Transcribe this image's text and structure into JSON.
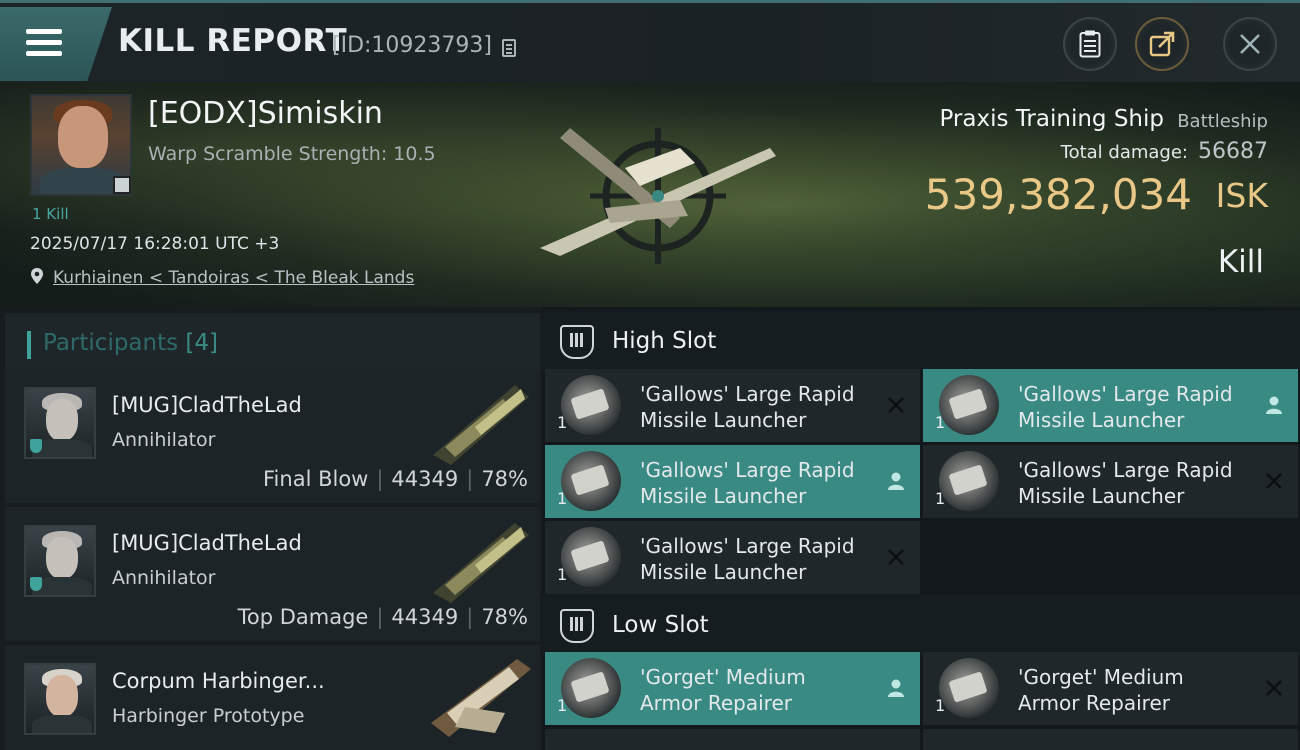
{
  "header": {
    "title": "KILL REPORT",
    "report_id": "[ID:10923793]"
  },
  "victim": {
    "name": "[EODX]Simiskin",
    "warp_scramble": "Warp Scramble Strength: 10.5",
    "kill_count": "1 Kill",
    "timestamp": "2025/07/17 16:28:01 UTC +3",
    "location": "Kurhiainen < Tandoiras < The Bleak Lands",
    "ship_name": "Praxis Training Ship",
    "ship_class": "Battleship",
    "damage_label": "Total damage:",
    "damage_value": "56687",
    "isk_value": "539,382,034",
    "isk_unit": "ISK",
    "result": "Kill"
  },
  "participants": {
    "title": "Participants",
    "count": "[4]",
    "rows": [
      {
        "name": "[MUG]CladTheLad",
        "ship": "Annihilator",
        "role": "Final Blow",
        "damage": "44349",
        "percent": "78%"
      },
      {
        "name": "[MUG]CladTheLad",
        "ship": "Annihilator",
        "role": "Top Damage",
        "damage": "44349",
        "percent": "78%"
      },
      {
        "name": "Corpum Harbinger...",
        "ship": "Harbinger Prototype",
        "role": "",
        "damage": "",
        "percent": ""
      }
    ]
  },
  "slots": {
    "high": {
      "title": "High Slot",
      "modules": [
        {
          "line1": "'Gallows' Large Rapid",
          "line2": "Missile Launcher",
          "qty": "1",
          "status": "destroyed-x-icon"
        },
        {
          "line1": "'Gallows' Large Rapid",
          "line2": "Missile Launcher",
          "qty": "1",
          "status": "dropped-person-icon"
        },
        {
          "line1": "'Gallows' Large Rapid",
          "line2": "Missile Launcher",
          "qty": "1",
          "status": "dropped-person-icon"
        },
        {
          "line1": "'Gallows' Large Rapid",
          "line2": "Missile Launcher",
          "qty": "1",
          "status": "destroyed-x-icon"
        },
        {
          "line1": "'Gallows' Large Rapid",
          "line2": "Missile Launcher",
          "qty": "1",
          "status": "destroyed-x-icon"
        }
      ]
    },
    "low": {
      "title": "Low Slot",
      "modules": [
        {
          "line1": "'Gorget' Medium",
          "line2": "Armor Repairer",
          "qty": "1",
          "status": "dropped-person-icon"
        },
        {
          "line1": "'Gorget' Medium",
          "line2": "Armor Repairer",
          "qty": "1",
          "status": "destroyed-x-icon"
        }
      ]
    }
  },
  "colors": {
    "accent_teal": "#3a8a84",
    "isk_gold": "#e9c887",
    "background": "#12181b"
  }
}
